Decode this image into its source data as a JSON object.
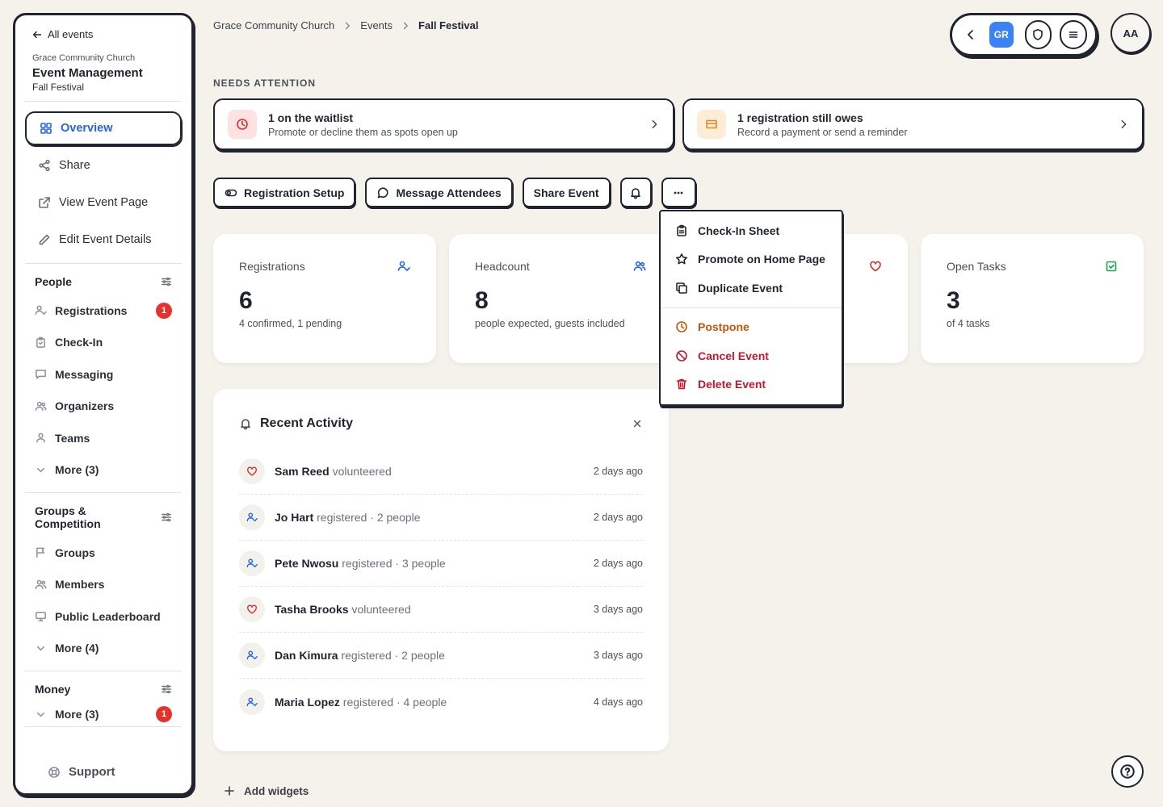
{
  "sidebar": {
    "back_label": "All events",
    "org": "Grace Community Church",
    "app": "Event Management",
    "event": "Fall Festival",
    "main_nav": [
      {
        "label": "Overview",
        "icon": "grid-icon"
      },
      {
        "label": "Share",
        "icon": "share-icon"
      },
      {
        "label": "View Event Page",
        "icon": "external-link-icon"
      },
      {
        "label": "Edit Event Details",
        "icon": "pencil-icon"
      }
    ],
    "sections": [
      {
        "title": "People",
        "items": [
          {
            "label": "Registrations",
            "badge": "1"
          },
          {
            "label": "Check-In"
          },
          {
            "label": "Messaging"
          },
          {
            "label": "Organizers"
          },
          {
            "label": "Teams"
          },
          {
            "label": "More (3)"
          }
        ]
      },
      {
        "title": "Groups & Competition",
        "items": [
          {
            "label": "Groups"
          },
          {
            "label": "Members"
          },
          {
            "label": "Public Leaderboard"
          },
          {
            "label": "More (4)"
          }
        ]
      },
      {
        "title": "Money",
        "items": [
          {
            "label": "More (3)",
            "badge": "1"
          }
        ]
      }
    ],
    "support": "Support"
  },
  "breadcrumb": [
    "Grace Community Church",
    "Events",
    "Fall Festival"
  ],
  "topbar": {
    "initials_badge": "GR",
    "avatar": "AA"
  },
  "needs_attention": {
    "label": "NEEDS ATTENTION",
    "alerts": [
      {
        "title": "1 on the waitlist",
        "subtitle": "Promote or decline them as spots open up"
      },
      {
        "title": "1 registration still owes",
        "subtitle": "Record a payment or send a reminder"
      }
    ]
  },
  "actions": {
    "registration_setup": "Registration Setup",
    "message_attendees": "Message Attendees",
    "share_event": "Share Event"
  },
  "stats": [
    {
      "title": "Registrations",
      "value": "6",
      "sub": "4 confirmed, 1 pending"
    },
    {
      "title": "Headcount",
      "value": "8",
      "sub": "people expected, guests included"
    },
    {
      "title": "",
      "value": "",
      "sub": ""
    },
    {
      "title": "Open Tasks",
      "value": "3",
      "sub": "of 4 tasks"
    }
  ],
  "activity": {
    "title": "Recent Activity",
    "rows": [
      {
        "name": "Sam Reed",
        "action": "volunteered",
        "time": "2 days ago",
        "kind": "heart"
      },
      {
        "name": "Jo Hart",
        "action": "registered · 2 people",
        "time": "2 days ago",
        "kind": "user"
      },
      {
        "name": "Pete Nwosu",
        "action": "registered · 3 people",
        "time": "2 days ago",
        "kind": "user"
      },
      {
        "name": "Tasha Brooks",
        "action": "volunteered",
        "time": "3 days ago",
        "kind": "heart"
      },
      {
        "name": "Dan Kimura",
        "action": "registered · 2 people",
        "time": "3 days ago",
        "kind": "user"
      },
      {
        "name": "Maria Lopez",
        "action": "registered · 4 people",
        "time": "4 days ago",
        "kind": "user"
      }
    ]
  },
  "add_widgets": "Add widgets",
  "dropdown": {
    "items": [
      {
        "label": "Check-In Sheet"
      },
      {
        "label": "Promote on Home Page"
      },
      {
        "label": "Duplicate Event"
      }
    ],
    "danger_items": [
      {
        "label": "Postpone"
      },
      {
        "label": "Cancel Event"
      },
      {
        "label": "Delete Event"
      }
    ]
  },
  "colors": {
    "accent": "#2563eb",
    "danger": "#c0182c",
    "warning": "#c2570c",
    "badge": "#e5322d",
    "gr_badge": "#3b82f6"
  }
}
